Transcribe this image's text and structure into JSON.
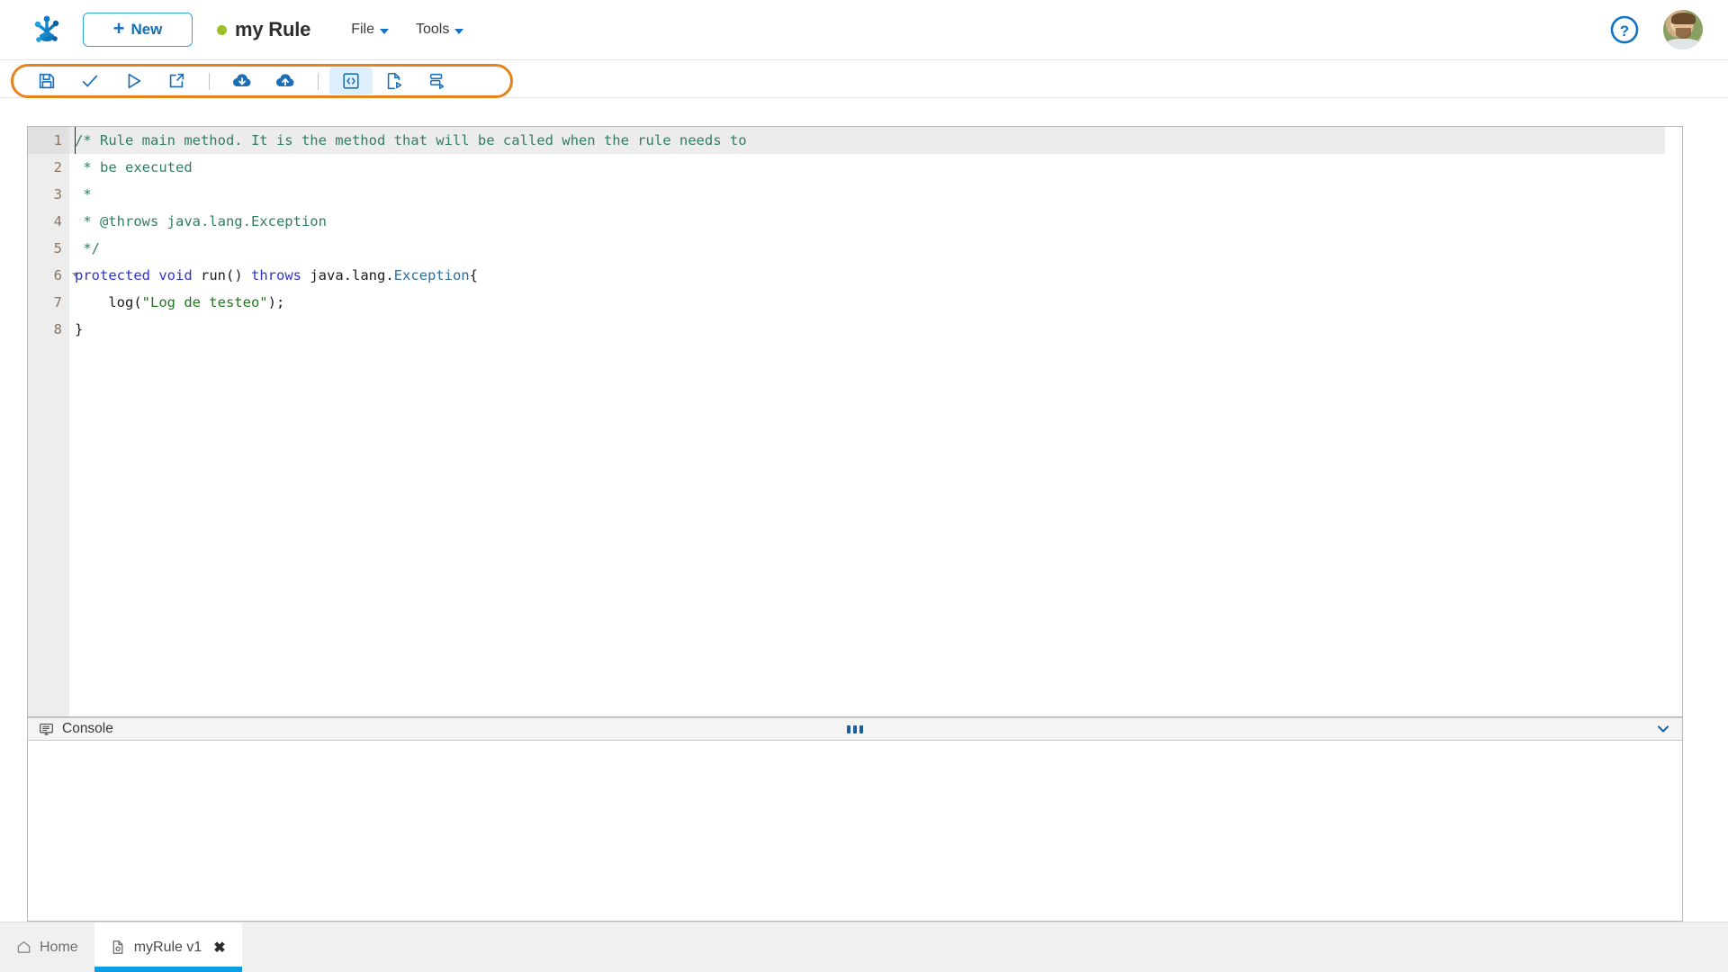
{
  "header": {
    "logo_icon": "frog-foot-logo",
    "new_button": {
      "label": "New",
      "icon": "plus-icon"
    },
    "document": {
      "title": "my Rule",
      "status_color": "#9dbf28",
      "status_icon": "status-dot"
    },
    "menus": [
      {
        "label": "File",
        "icon": "chevron-down-icon"
      },
      {
        "label": "Tools",
        "icon": "chevron-down-icon"
      }
    ],
    "help_icon": "help-circle-icon",
    "avatar_icon": "user-avatar"
  },
  "toolbar": {
    "highlight_color": "#e8821a",
    "items": [
      {
        "name": "save-button",
        "icon": "floppy-disk-icon",
        "tooltip": "Save",
        "active": false
      },
      {
        "name": "validate-button",
        "icon": "check-icon",
        "tooltip": "Validate",
        "active": false
      },
      {
        "name": "run-button",
        "icon": "play-triangle-icon",
        "tooltip": "Run",
        "active": false
      },
      {
        "name": "open-external-button",
        "icon": "external-link-arrow-icon",
        "tooltip": "Open in new window",
        "active": false
      },
      {
        "name": "separator-1",
        "icon": "divider",
        "tooltip": "",
        "active": false
      },
      {
        "name": "download-button",
        "icon": "cloud-download-icon",
        "tooltip": "Download",
        "active": false
      },
      {
        "name": "upload-button",
        "icon": "cloud-upload-icon",
        "tooltip": "Upload",
        "active": false
      },
      {
        "name": "separator-2",
        "icon": "divider",
        "tooltip": "",
        "active": false
      },
      {
        "name": "source-code-button",
        "icon": "code-brackets-icon",
        "tooltip": "Source code",
        "active": true
      },
      {
        "name": "new-document-button",
        "icon": "document-play-icon",
        "tooltip": "New document",
        "active": false
      },
      {
        "name": "database-button",
        "icon": "database-stack-icon",
        "tooltip": "Database",
        "active": false
      }
    ]
  },
  "editor": {
    "language": "java",
    "active_line": 1,
    "lines": [
      {
        "n": "1",
        "fold": true,
        "highlight": true,
        "tokens": [
          {
            "t": "comment",
            "v": "/* Rule main method. It is the method that will be called when the rule needs to"
          }
        ]
      },
      {
        "n": "2",
        "fold": false,
        "highlight": false,
        "tokens": [
          {
            "t": "comment",
            "v": " * be executed"
          }
        ]
      },
      {
        "n": "3",
        "fold": false,
        "highlight": false,
        "tokens": [
          {
            "t": "comment",
            "v": " *"
          }
        ]
      },
      {
        "n": "4",
        "fold": false,
        "highlight": false,
        "tokens": [
          {
            "t": "comment",
            "v": " * @throws java.lang.Exception"
          }
        ]
      },
      {
        "n": "5",
        "fold": false,
        "highlight": false,
        "tokens": [
          {
            "t": "comment",
            "v": " */"
          }
        ]
      },
      {
        "n": "6",
        "fold": true,
        "highlight": false,
        "tokens": [
          {
            "t": "keyword",
            "v": "protected"
          },
          {
            "t": "plain",
            "v": " "
          },
          {
            "t": "keyword",
            "v": "void"
          },
          {
            "t": "plain",
            "v": " run() "
          },
          {
            "t": "keyword",
            "v": "throws"
          },
          {
            "t": "plain",
            "v": " java.lang."
          },
          {
            "t": "type",
            "v": "Exception"
          },
          {
            "t": "plain",
            "v": "{"
          }
        ]
      },
      {
        "n": "7",
        "fold": false,
        "highlight": false,
        "tokens": [
          {
            "t": "plain",
            "v": "    log("
          },
          {
            "t": "string",
            "v": "\"Log de testeo\""
          },
          {
            "t": "plain",
            "v": ");"
          }
        ]
      },
      {
        "n": "8",
        "fold": false,
        "highlight": false,
        "tokens": [
          {
            "t": "plain",
            "v": "}"
          }
        ]
      }
    ]
  },
  "console": {
    "title": "Console",
    "icon": "console-monitor-icon",
    "drag_handle_icon": "ellipsis-drag-icon",
    "collapse_icon": "chevron-down-icon",
    "body_text": ""
  },
  "tabbar": {
    "tabs": [
      {
        "label": "Home",
        "icon": "home-icon",
        "active": false,
        "closable": false
      },
      {
        "label": "myRule v1",
        "icon": "rule-document-icon",
        "active": true,
        "closable": true,
        "close_icon": "close-x-icon"
      }
    ],
    "active_indicator_color": "#0b9de8"
  }
}
